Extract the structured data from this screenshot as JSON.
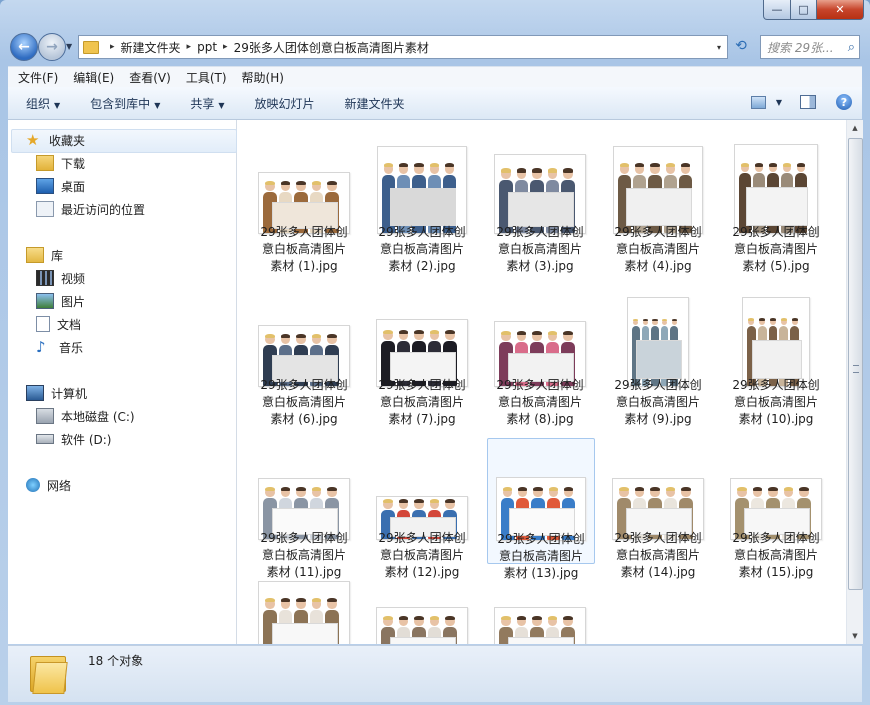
{
  "window": {
    "min_label": "—",
    "max_label": "□",
    "close_label": "✕"
  },
  "nav_buttons": {
    "back": "←",
    "forward": "→"
  },
  "address": {
    "crumbs": [
      "新建文件夹",
      "ppt",
      "29张多人团体创意白板高清图片素材"
    ],
    "separator": "▸",
    "dropdown": "▾"
  },
  "refresh": "⟲",
  "search": {
    "placeholder": "搜索 29张...",
    "icon": "🔍"
  },
  "menu": [
    "文件(F)",
    "编辑(E)",
    "查看(V)",
    "工具(T)",
    "帮助(H)"
  ],
  "toolbar": {
    "organize": "组织",
    "include_library": "包含到库中",
    "share": "共享",
    "slideshow": "放映幻灯片",
    "new_folder": "新建文件夹",
    "arrow": "▼",
    "help": "?"
  },
  "sidebar": {
    "favorites": {
      "label": "收藏夹",
      "icon": "star-icon"
    },
    "fav_items": [
      {
        "label": "下载",
        "icon": "download-folder-icon"
      },
      {
        "label": "桌面",
        "icon": "desktop-icon"
      },
      {
        "label": "最近访问的位置",
        "icon": "recent-places-icon"
      }
    ],
    "libraries": {
      "label": "库",
      "icon": "library-icon"
    },
    "lib_items": [
      {
        "label": "视频",
        "icon": "video-icon"
      },
      {
        "label": "图片",
        "icon": "pictures-icon"
      },
      {
        "label": "文档",
        "icon": "documents-icon"
      },
      {
        "label": "音乐",
        "icon": "music-icon"
      }
    ],
    "computer": {
      "label": "计算机",
      "icon": "computer-icon"
    },
    "drives": [
      {
        "label": "本地磁盘 (C:)",
        "icon": "drive-c-icon"
      },
      {
        "label": "软件 (D:)",
        "icon": "drive-d-icon"
      }
    ],
    "network": {
      "label": "网络",
      "icon": "network-icon"
    }
  },
  "files": [
    {
      "line1": "29张多人团体创",
      "line2": "意白板高清图片",
      "line3": "素材 (1).jpg"
    },
    {
      "line1": "29张多人团体创",
      "line2": "意白板高清图片",
      "line3": "素材 (2).jpg"
    },
    {
      "line1": "29张多人团体创",
      "line2": "意白板高清图片",
      "line3": "素材 (3).jpg"
    },
    {
      "line1": "29张多人团体创",
      "line2": "意白板高清图片",
      "line3": "素材 (4).jpg"
    },
    {
      "line1": "29张多人团体创",
      "line2": "意白板高清图片",
      "line3": "素材 (5).jpg"
    },
    {
      "line1": "29张多人团体创",
      "line2": "意白板高清图片",
      "line3": "素材 (6).jpg"
    },
    {
      "line1": "29张多人团体创",
      "line2": "意白板高清图片",
      "line3": "素材 (7).jpg"
    },
    {
      "line1": "29张多人团体创",
      "line2": "意白板高清图片",
      "line3": "素材 (8).jpg"
    },
    {
      "line1": "29张多人团体创",
      "line2": "意白板高清图片",
      "line3": "素材 (9).jpg"
    },
    {
      "line1": "29张多人团体创",
      "line2": "意白板高清图片",
      "line3": "素材 (10).jpg"
    },
    {
      "line1": "29张多人团体创",
      "line2": "意白板高清图片",
      "line3": "素材 (11).jpg"
    },
    {
      "line1": "29张多人团体创",
      "line2": "意白板高清图片",
      "line3": "素材 (12).jpg"
    },
    {
      "line1": "29张多人团体创",
      "line2": "意白板高清图片",
      "line3": "素材 (13).jpg"
    },
    {
      "line1": "29张多人团体创",
      "line2": "意白板高清图片",
      "line3": "素材 (14).jpg"
    },
    {
      "line1": "29张多人团体创",
      "line2": "意白板高清图片",
      "line3": "素材 (15).jpg"
    },
    {
      "line1": "",
      "line2": "",
      "line3": ""
    },
    {
      "line1": "",
      "line2": "",
      "line3": ""
    },
    {
      "line1": "",
      "line2": "",
      "line3": ""
    }
  ],
  "selected_file_index": 12,
  "status": {
    "count": "18 个对象"
  },
  "colors": {
    "accent": "#2f6cc1",
    "close": "#c7452b",
    "selection": "#a6c8ee"
  }
}
